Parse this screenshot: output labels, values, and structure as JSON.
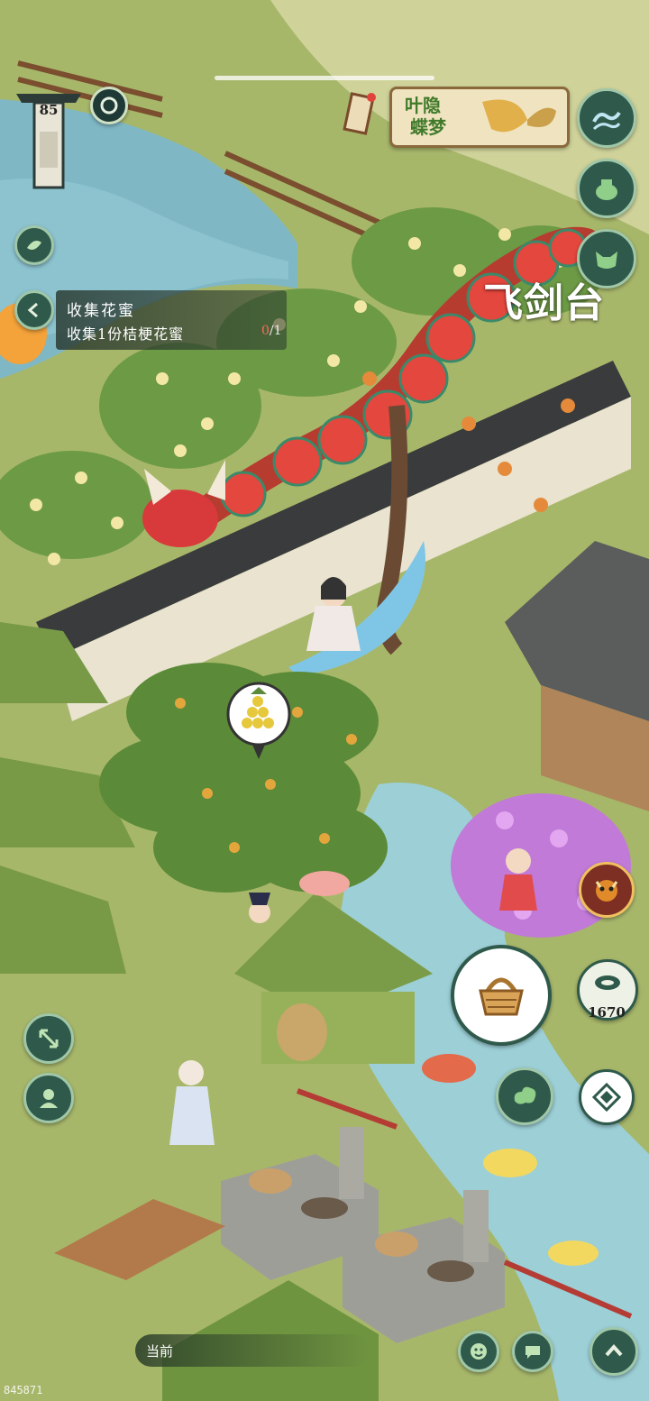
{
  "hud": {
    "level": "85",
    "event_title_line1": "叶隐",
    "event_title_line2": "蝶梦",
    "location_name": "飞剑台"
  },
  "quest": {
    "title": "收集花蜜",
    "description": "收集1份桔梗花蜜",
    "progress_current": "0",
    "progress_total": "/1"
  },
  "resources": {
    "coin_count": "1670"
  },
  "footer": {
    "current_label": "当前",
    "player_id": "845871"
  },
  "icons": [
    "level-banner-icon",
    "ring-icon",
    "scroll-icon",
    "wave-icon",
    "pot-icon",
    "mask-icon",
    "leaf-icon",
    "back-arrow-icon",
    "basket-icon",
    "coin-icon",
    "cloud-icon",
    "compass-icon",
    "monster-event-icon",
    "expand-icon",
    "character-icon",
    "emoji-icon",
    "chat-icon",
    "up-arrow-icon",
    "berry-bubble-icon"
  ],
  "colors": {
    "hud": "#2f5a4b",
    "accent_red": "#e0433b",
    "panel": "#28372d"
  }
}
